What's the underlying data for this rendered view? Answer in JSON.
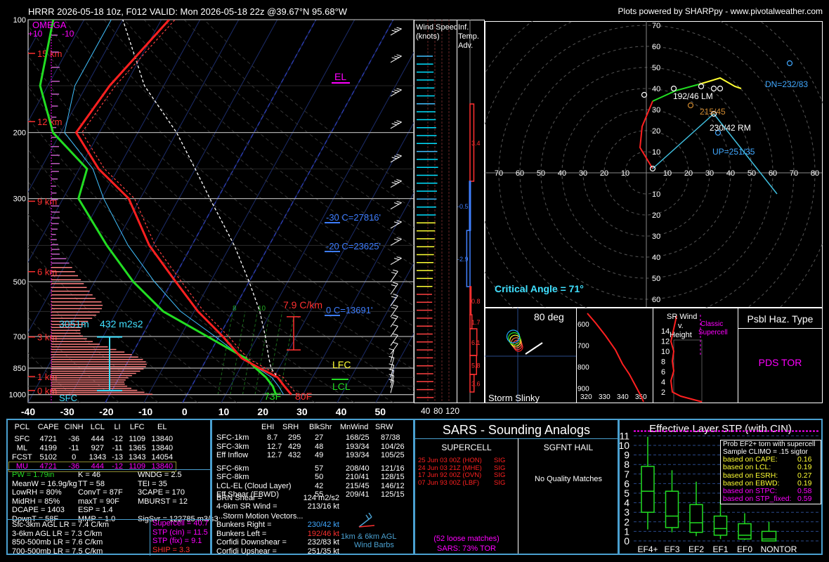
{
  "header": {
    "title": "HRRR 2026-05-18 10z, F012  VALID: Mon 2026-05-18 22z @39.67°N 95.68°W",
    "credit": "Plots powered by SHARPpy - www.pivotalweather.com"
  },
  "skewt": {
    "pressure_ticks": [
      "100",
      "200",
      "300",
      "500",
      "700",
      "850",
      "1000"
    ],
    "temp_ticks": [
      "-40",
      "-30",
      "-20",
      "-10",
      "0",
      "10",
      "20",
      "30",
      "40",
      "50"
    ],
    "height_labels": [
      "15 km",
      "12 km",
      "9 km",
      "6 km",
      "3 km",
      "1 km",
      "0 km"
    ],
    "omega_title": "OMEGA",
    "omega_ticks": [
      "+10",
      "-10"
    ],
    "el_label": "EL",
    "lfc_label": "LFC",
    "lcl_label": "LCL",
    "sfc_label": "SFC",
    "isotherm_labels": [
      "-30 C=27816'",
      "-20 C=23625'",
      "0 C=13691'"
    ],
    "lapse_label": "7.9 C/km",
    "srh_depth": "3051m",
    "srh_value": "432 m2s2",
    "sfc_temp": "80F",
    "sfc_dew": "73F",
    "mixing_ticks": [
      "8",
      "10"
    ]
  },
  "chart_data": {
    "type": "line",
    "title": "",
    "xlabel": "",
    "ylabel": "",
    "ylim": [
      1050,
      100
    ],
    "xlim": [
      -40,
      50
    ],
    "series": [
      {
        "name": "",
        "x": [
          27.0,
          24.0,
          21.0,
          15.0,
          9.0,
          1.0,
          -9.0,
          -19.0,
          -31.0,
          -43.0,
          -55.0,
          -66.0,
          -64.0,
          -58.0
        ],
        "y": [
          1000,
          950,
          900,
          850,
          800,
          700,
          600,
          500,
          400,
          300,
          250,
          200,
          150,
          100
        ]
      },
      {
        "name": "",
        "x": [
          23.0,
          21.0,
          18.0,
          14.0,
          10.0,
          -3.0,
          -18.0,
          -30.0,
          -42.0,
          -56.0,
          -58.0,
          -72.0,
          -82.0,
          -88.0
        ],
        "y": [
          1000,
          950,
          900,
          850,
          800,
          700,
          600,
          500,
          400,
          300,
          250,
          200,
          150,
          100
        ]
      }
    ]
  },
  "wind_profile": {
    "title1": "Wind Speed",
    "title2": "(knots)",
    "ticks": [
      "40",
      "80",
      "120"
    ]
  },
  "inf_temp": {
    "title1": "Inf.",
    "title2": "Temp.",
    "title3": "Adv.",
    "values": [
      "3.4",
      "-0.5",
      "-2.9",
      "0.8",
      "1.7",
      "6.1",
      "5.8",
      "3.6"
    ]
  },
  "hodograph": {
    "axis_ticks": [
      "80",
      "70",
      "60",
      "50",
      "40",
      "30",
      "20",
      "10"
    ],
    "labels": {
      "lm": "192/46 LM",
      "mean": "215/45",
      "rm": "230/42 RM",
      "dn": "DN=232/83",
      "up": "UP=251/35"
    },
    "critical_angle": "Critical Angle = 71°"
  },
  "slinky": {
    "label": "Storm Slinky",
    "angle": "80 deg"
  },
  "theta": {
    "pticks": [
      "600",
      "700",
      "800",
      "900"
    ],
    "thticks": [
      "320",
      "330",
      "340",
      "350"
    ]
  },
  "srwind": {
    "title1": "SR Wind",
    "title2": "v.",
    "title3": "Height",
    "classic1": "Classic",
    "classic2": "Supercell",
    "hticks": [
      "14",
      "12",
      "10",
      "8",
      "6",
      "4",
      "2"
    ]
  },
  "hazard": {
    "title": "Psbl Haz. Type",
    "value": "PDS TOR"
  },
  "parcels": {
    "headers": [
      "PCL",
      "CAPE",
      "CINH",
      "LCL",
      "LI",
      "LFC",
      "EL"
    ],
    "rows": [
      [
        "SFC",
        "4721",
        "-36",
        "444",
        "-12",
        "1109",
        "13840"
      ],
      [
        "ML",
        "4199",
        "-11",
        "927",
        "-11",
        "1365",
        "13840"
      ],
      [
        "FCST",
        "5102",
        "0",
        "1343",
        "-13",
        "1343",
        "14054"
      ],
      [
        "MU",
        "4721",
        "-36",
        "444",
        "-12",
        "1109",
        "13840"
      ]
    ]
  },
  "indices": {
    "col1": [
      "PW = 1.79in",
      "MeanW = 16.9g/kg",
      "LowRH = 80%",
      "MidRH = 85%",
      "DCAPE = 1403",
      "DownT = 58F"
    ],
    "col2": [
      "K = 46",
      "TT = 58",
      "ConvT = 87F",
      "maxT = 90F",
      "ESP = 1.4",
      "MMP = 1.0"
    ],
    "col3": [
      "WNDG = 2.5",
      "TEI = 35",
      "3CAPE = 170",
      "MBURST = 12",
      "",
      "SigSvr = 122785 m3/s3"
    ],
    "lapse": [
      "Sfc-3km AGL LR = 7.4 C/km",
      "3-6km AGL LR = 7.3 C/km",
      "850-500mb LR = 7.6 C/km",
      "700-500mb LR = 7.5 C/km"
    ],
    "composite": [
      "Supercell = 40.7",
      "STP (cin) = 11.5",
      "STP (fix) = 9.1",
      "SHIP = 3.3"
    ]
  },
  "kinematics": {
    "headers": [
      "EHI",
      "SRH",
      "BlkShr",
      "MnWind",
      "SRW"
    ],
    "rows": [
      [
        "SFC-1km",
        "8.7",
        "295",
        "27",
        "168/25",
        "87/38"
      ],
      [
        "SFC-3km",
        "12.7",
        "429",
        "48",
        "193/34",
        "104/26"
      ],
      [
        "Eff Inflow",
        "12.7",
        "432",
        "49",
        "193/34",
        "105/25"
      ],
      [
        "SFC-6km",
        "",
        "",
        "57",
        "208/40",
        "121/16"
      ],
      [
        "SFC-8km",
        "",
        "",
        "50",
        "210/41",
        "128/15"
      ],
      [
        "LCL-EL (Cloud Layer)",
        "",
        "",
        "42",
        "215/45",
        "146/12"
      ],
      [
        "Eff Shear (EBWD)",
        "",
        "",
        "55",
        "209/41",
        "125/15"
      ]
    ],
    "brn_label": "BRN Shear =",
    "brn_value": "124 m2/s2",
    "sr46_label": "4-6km SR Wind =",
    "sr46_value": "213/16 kt",
    "storm_title": "...Storm Motion Vectors...",
    "motion": [
      [
        "Bunkers Right =",
        "230/42 kt"
      ],
      [
        "Bunkers Left =",
        "192/46 kt"
      ],
      [
        "Corfidi Downshear =",
        "232/83 kt"
      ],
      [
        "Corfidi Upshear =",
        "251/35 kt"
      ]
    ],
    "barb_label1": "1km & 6km AGL",
    "barb_label2": "Wind Barbs"
  },
  "sars": {
    "title": "SARS - Sounding Analogs",
    "supercell_title": "SUPERCELL",
    "hail_title": "SGFNT HAIL",
    "matches": [
      [
        "25 Jun 03 00Z (HON)",
        "SIG"
      ],
      [
        "24 Jun 03 21Z (MHE)",
        "SIG"
      ],
      [
        "17 Jun 92 00Z (OVN)",
        "SIG"
      ],
      [
        "07 Jun 93 00Z (LBF)",
        "SIG"
      ]
    ],
    "hail_result": "No Quality Matches",
    "loose": "(52 loose matches)",
    "pct": "SARS: 73% TOR"
  },
  "stp": {
    "title": "Effective Layer STP (with CIN)",
    "yticks": [
      "0",
      "1",
      "2",
      "3",
      "4",
      "5",
      "6",
      "7",
      "8",
      "9",
      "10",
      "11"
    ],
    "categories": [
      "EF4+",
      "EF3",
      "EF2",
      "EF1",
      "EF0",
      "NONTOR"
    ],
    "boxes": [
      {
        "low": 1.2,
        "q1": 3.0,
        "med": 5.2,
        "q3": 7.8,
        "high": 10.9
      },
      {
        "low": 0.9,
        "q1": 1.4,
        "med": 2.6,
        "q3": 5.2,
        "high": 7.4
      },
      {
        "low": 0.5,
        "q1": 0.9,
        "med": 1.9,
        "q3": 3.8,
        "high": 6.2
      },
      {
        "low": 0.2,
        "q1": 0.6,
        "med": 1.3,
        "q3": 2.6,
        "high": 4.3
      },
      {
        "low": 0.1,
        "q1": 0.2,
        "med": 0.6,
        "q3": 1.8,
        "high": 2.9
      },
      {
        "low": 0.0,
        "q1": 0.0,
        "med": 0.2,
        "q3": 1.0,
        "high": 2.0
      }
    ],
    "stp_value": 11.5,
    "prob_title1": "Prob EF2+ torn with supercell",
    "prob_title2": "Sample CLIMO = .15 sigtor",
    "probs": [
      [
        "based on CAPE:",
        "0.16"
      ],
      [
        "based on LCL:",
        "0.19"
      ],
      [
        "based on ESRH:",
        "0.27"
      ],
      [
        "based on EBWD:",
        "0.19"
      ],
      [
        "based on STPC:",
        "0.58"
      ],
      [
        "based on STP_fixed:",
        "0.59"
      ]
    ]
  },
  "colors": {
    "temp": "#ff2020",
    "dew": "#22dd22",
    "accent": "#4aa0d0",
    "magenta": "#ff00ff",
    "cyan": "#00ffff",
    "yellow": "#ffff33"
  }
}
